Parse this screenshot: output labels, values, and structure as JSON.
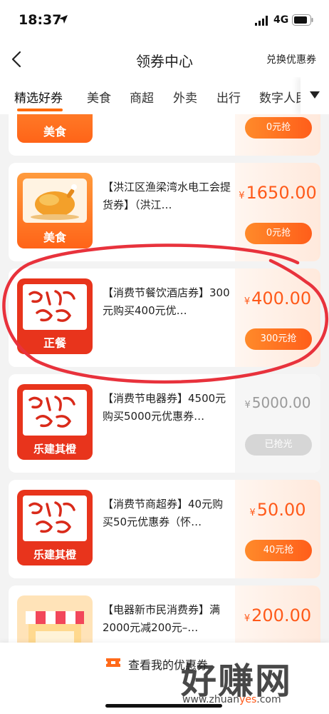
{
  "status_bar": {
    "time": "18:37",
    "network": "4G"
  },
  "header": {
    "title": "领券中心",
    "exchange_label": "兑换优惠券"
  },
  "tabs": [
    "精选好券",
    "美食",
    "商超",
    "外卖",
    "出行",
    "数字人民币"
  ],
  "cards": [
    {
      "thumb_label": "美食",
      "description": "",
      "price": "",
      "button": "0元抢",
      "grabbed": false
    },
    {
      "thumb_label": "美食",
      "description": "【洪江区渔梁湾水电工会提货券】（洪江…",
      "price": "1650.00",
      "button": "0元抢",
      "grabbed": false
    },
    {
      "thumb_label": "正餐",
      "description": "【消费节餐饮酒店券】300元购买400元优…",
      "price": "400.00",
      "button": "300元抢",
      "grabbed": false
    },
    {
      "thumb_label": "乐建其橙",
      "description": "【消费节电器券】4500元购买5000元优惠券…",
      "price": "5000.00",
      "button": "已抢光",
      "grabbed": true
    },
    {
      "thumb_label": "乐建其橙",
      "description": "【消费节商超券】40元购买50元优惠券（怀…",
      "price": "50.00",
      "button": "40元抢",
      "grabbed": false
    },
    {
      "thumb_label": "",
      "description": "【电器新市民消费券】满2000元减200元–…",
      "price": "200.00",
      "button": "",
      "grabbed": false
    }
  ],
  "currency_symbol": "¥",
  "bottom": {
    "my_coupons_label": "查看我的优惠券"
  },
  "watermark": {
    "text": "好赚网",
    "url_prefix": "www.zhuan",
    "url_highlight": "yes",
    "url_suffix": ".com"
  },
  "colors": {
    "accent": "#ff5a1a",
    "annotation": "#e8323c"
  },
  "icons": {
    "back": "chevron-left-icon",
    "tabs_more": "triangle-down-icon",
    "coupon": "coupon-icon"
  }
}
